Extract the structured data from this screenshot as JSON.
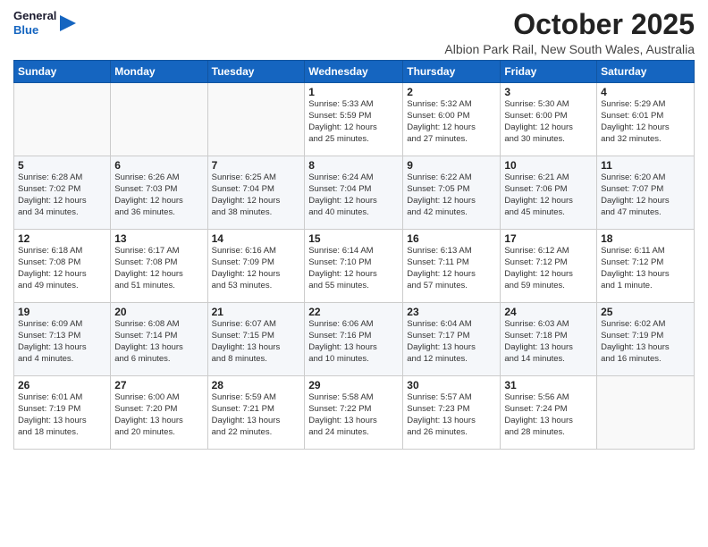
{
  "header": {
    "logo_line1": "General",
    "logo_line2": "Blue",
    "month": "October 2025",
    "location": "Albion Park Rail, New South Wales, Australia"
  },
  "weekdays": [
    "Sunday",
    "Monday",
    "Tuesday",
    "Wednesday",
    "Thursday",
    "Friday",
    "Saturday"
  ],
  "weeks": [
    [
      {
        "day": "",
        "info": ""
      },
      {
        "day": "",
        "info": ""
      },
      {
        "day": "",
        "info": ""
      },
      {
        "day": "1",
        "info": "Sunrise: 5:33 AM\nSunset: 5:59 PM\nDaylight: 12 hours\nand 25 minutes."
      },
      {
        "day": "2",
        "info": "Sunrise: 5:32 AM\nSunset: 6:00 PM\nDaylight: 12 hours\nand 27 minutes."
      },
      {
        "day": "3",
        "info": "Sunrise: 5:30 AM\nSunset: 6:00 PM\nDaylight: 12 hours\nand 30 minutes."
      },
      {
        "day": "4",
        "info": "Sunrise: 5:29 AM\nSunset: 6:01 PM\nDaylight: 12 hours\nand 32 minutes."
      }
    ],
    [
      {
        "day": "5",
        "info": "Sunrise: 6:28 AM\nSunset: 7:02 PM\nDaylight: 12 hours\nand 34 minutes."
      },
      {
        "day": "6",
        "info": "Sunrise: 6:26 AM\nSunset: 7:03 PM\nDaylight: 12 hours\nand 36 minutes."
      },
      {
        "day": "7",
        "info": "Sunrise: 6:25 AM\nSunset: 7:04 PM\nDaylight: 12 hours\nand 38 minutes."
      },
      {
        "day": "8",
        "info": "Sunrise: 6:24 AM\nSunset: 7:04 PM\nDaylight: 12 hours\nand 40 minutes."
      },
      {
        "day": "9",
        "info": "Sunrise: 6:22 AM\nSunset: 7:05 PM\nDaylight: 12 hours\nand 42 minutes."
      },
      {
        "day": "10",
        "info": "Sunrise: 6:21 AM\nSunset: 7:06 PM\nDaylight: 12 hours\nand 45 minutes."
      },
      {
        "day": "11",
        "info": "Sunrise: 6:20 AM\nSunset: 7:07 PM\nDaylight: 12 hours\nand 47 minutes."
      }
    ],
    [
      {
        "day": "12",
        "info": "Sunrise: 6:18 AM\nSunset: 7:08 PM\nDaylight: 12 hours\nand 49 minutes."
      },
      {
        "day": "13",
        "info": "Sunrise: 6:17 AM\nSunset: 7:08 PM\nDaylight: 12 hours\nand 51 minutes."
      },
      {
        "day": "14",
        "info": "Sunrise: 6:16 AM\nSunset: 7:09 PM\nDaylight: 12 hours\nand 53 minutes."
      },
      {
        "day": "15",
        "info": "Sunrise: 6:14 AM\nSunset: 7:10 PM\nDaylight: 12 hours\nand 55 minutes."
      },
      {
        "day": "16",
        "info": "Sunrise: 6:13 AM\nSunset: 7:11 PM\nDaylight: 12 hours\nand 57 minutes."
      },
      {
        "day": "17",
        "info": "Sunrise: 6:12 AM\nSunset: 7:12 PM\nDaylight: 12 hours\nand 59 minutes."
      },
      {
        "day": "18",
        "info": "Sunrise: 6:11 AM\nSunset: 7:12 PM\nDaylight: 13 hours\nand 1 minute."
      }
    ],
    [
      {
        "day": "19",
        "info": "Sunrise: 6:09 AM\nSunset: 7:13 PM\nDaylight: 13 hours\nand 4 minutes."
      },
      {
        "day": "20",
        "info": "Sunrise: 6:08 AM\nSunset: 7:14 PM\nDaylight: 13 hours\nand 6 minutes."
      },
      {
        "day": "21",
        "info": "Sunrise: 6:07 AM\nSunset: 7:15 PM\nDaylight: 13 hours\nand 8 minutes."
      },
      {
        "day": "22",
        "info": "Sunrise: 6:06 AM\nSunset: 7:16 PM\nDaylight: 13 hours\nand 10 minutes."
      },
      {
        "day": "23",
        "info": "Sunrise: 6:04 AM\nSunset: 7:17 PM\nDaylight: 13 hours\nand 12 minutes."
      },
      {
        "day": "24",
        "info": "Sunrise: 6:03 AM\nSunset: 7:18 PM\nDaylight: 13 hours\nand 14 minutes."
      },
      {
        "day": "25",
        "info": "Sunrise: 6:02 AM\nSunset: 7:19 PM\nDaylight: 13 hours\nand 16 minutes."
      }
    ],
    [
      {
        "day": "26",
        "info": "Sunrise: 6:01 AM\nSunset: 7:19 PM\nDaylight: 13 hours\nand 18 minutes."
      },
      {
        "day": "27",
        "info": "Sunrise: 6:00 AM\nSunset: 7:20 PM\nDaylight: 13 hours\nand 20 minutes."
      },
      {
        "day": "28",
        "info": "Sunrise: 5:59 AM\nSunset: 7:21 PM\nDaylight: 13 hours\nand 22 minutes."
      },
      {
        "day": "29",
        "info": "Sunrise: 5:58 AM\nSunset: 7:22 PM\nDaylight: 13 hours\nand 24 minutes."
      },
      {
        "day": "30",
        "info": "Sunrise: 5:57 AM\nSunset: 7:23 PM\nDaylight: 13 hours\nand 26 minutes."
      },
      {
        "day": "31",
        "info": "Sunrise: 5:56 AM\nSunset: 7:24 PM\nDaylight: 13 hours\nand 28 minutes."
      },
      {
        "day": "",
        "info": ""
      }
    ]
  ]
}
